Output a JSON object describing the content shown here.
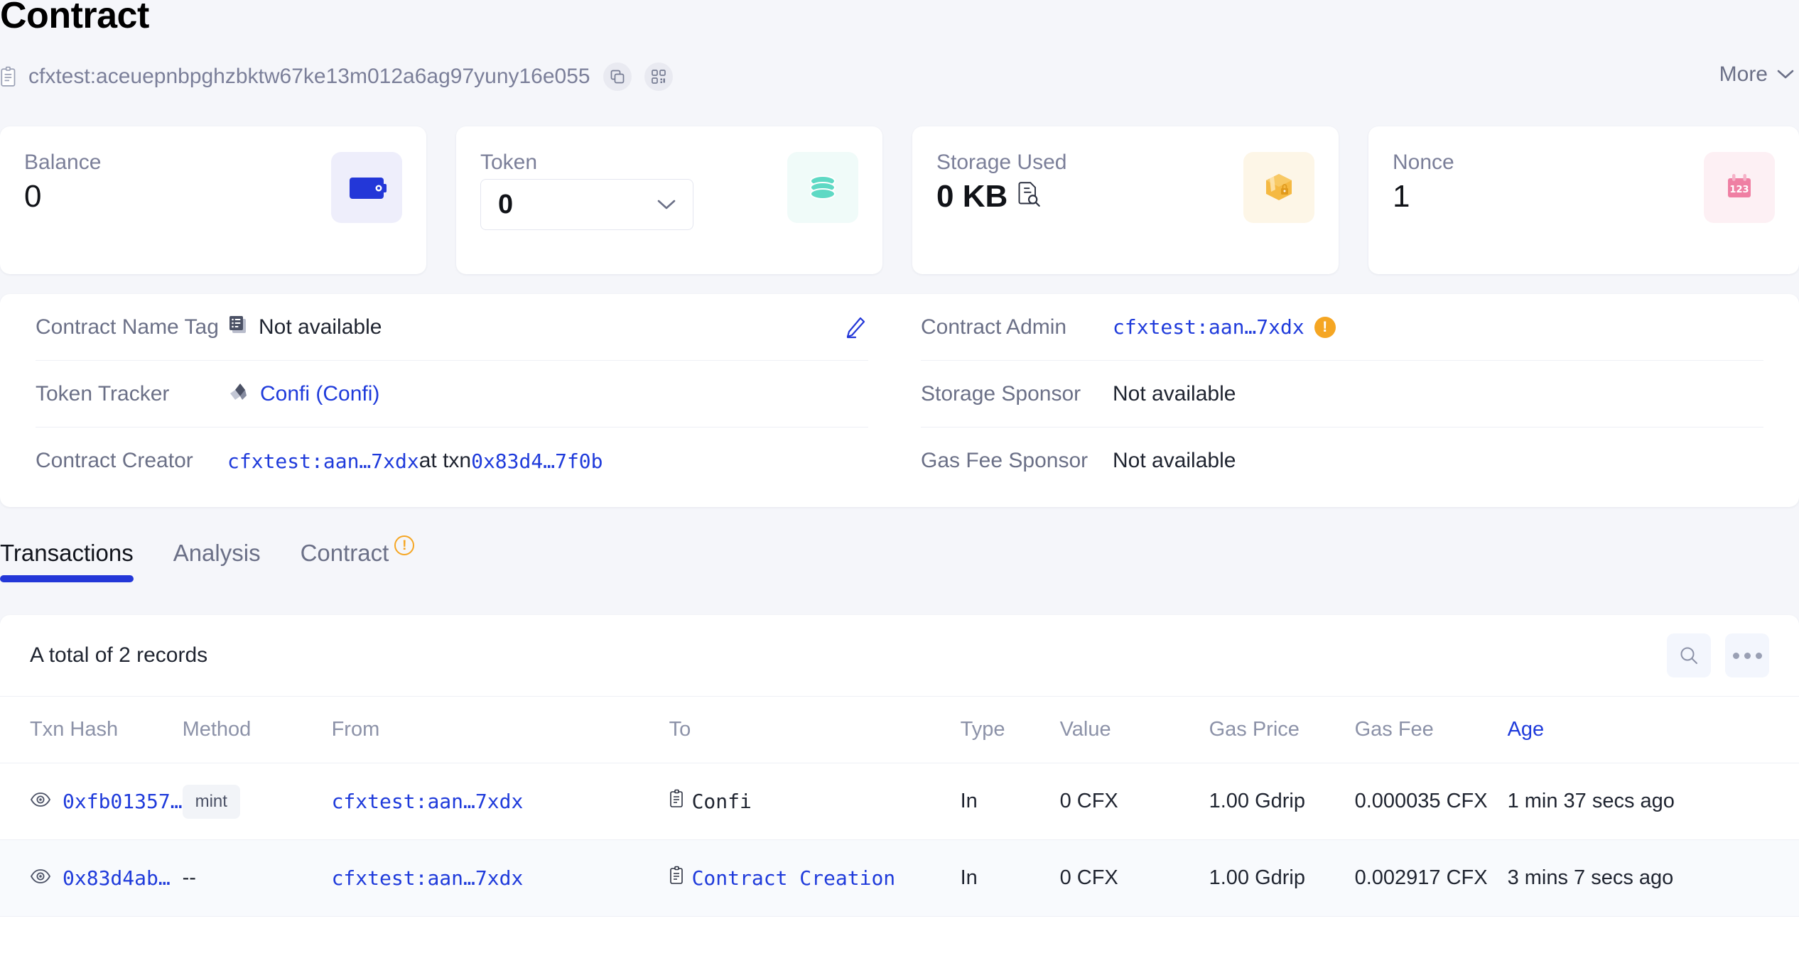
{
  "header": {
    "title": "Contract",
    "address": "cfxtest:aceuepnbpghzbktw67ke13m012a6ag97yuny16e055",
    "copy_icon": "copy-icon",
    "qr_icon": "qrcode-icon",
    "doc_icon": "contract-doc-icon",
    "more_label": "More",
    "more_icon": "chevron-down-icon"
  },
  "cards": [
    {
      "label": "Balance",
      "value": "0",
      "icon": "wallet-icon",
      "accent": "#2337d8",
      "bg": "#eeeefb"
    },
    {
      "label": "Token",
      "value": "0",
      "icon": "coins-icon",
      "accent": "#5fd9c4",
      "bg": "#f0fbf9",
      "is_select": true,
      "select_icon": "chevron-down-icon"
    },
    {
      "label": "Storage Used",
      "value": "0 KB",
      "icon": "package-lock-icon",
      "accent": "#f5b942",
      "bg": "#fdf6e7",
      "value_icon": "doc-search-icon"
    },
    {
      "label": "Nonce",
      "value": "1",
      "icon": "calendar-123-icon",
      "accent": "#ef7fa3",
      "bg": "#fdf0f4"
    }
  ],
  "info_left": [
    {
      "key": "Contract Name Tag",
      "value": "Not available",
      "icon": "server-stack-icon",
      "has_edit": true,
      "edit_icon": "pencil-icon"
    },
    {
      "key": "Token Tracker",
      "value": "Confi (Confi)",
      "icon": "token-tracker-icon",
      "is_link": true
    },
    {
      "key": "Contract Creator",
      "value_link1": "cfxtest:aan…7xdx",
      "value_mid": " at txn ",
      "value_link2": "0x83d4…7f0b"
    }
  ],
  "info_right": [
    {
      "key": "Contract Admin",
      "value": "cfxtest:aan…7xdx",
      "is_link": true,
      "badge": "!",
      "badge_icon": "warning-badge-icon"
    },
    {
      "key": "Storage Sponsor",
      "value": "Not available"
    },
    {
      "key": "Gas Fee Sponsor",
      "value": "Not available"
    }
  ],
  "tabs": [
    {
      "label": "Transactions",
      "active": true
    },
    {
      "label": "Analysis",
      "active": false
    },
    {
      "label": "Contract",
      "active": false,
      "warn": "!",
      "warn_icon": "warning-circle-icon"
    }
  ],
  "table": {
    "records_text": "A total of 2 records",
    "search_icon": "search-icon",
    "more_icon": "ellipsis-icon",
    "columns": [
      "Txn Hash",
      "Method",
      "From",
      "To",
      "Type",
      "Value",
      "Gas Price",
      "Gas Fee",
      "Age"
    ],
    "sorted_column": "Age",
    "rows": [
      {
        "eye_icon": "eye-icon",
        "hash": "0xfb01357…",
        "method": "mint",
        "from": "cfxtest:aan…7xdx",
        "to": "Confi",
        "to_icon": "contract-doc-icon",
        "to_is_link": false,
        "type": "In",
        "value": "0 CFX",
        "gas_price": "1.00 Gdrip",
        "gas_fee": "0.000035 CFX",
        "age": "1 min 37 secs ago"
      },
      {
        "eye_icon": "eye-icon",
        "hash": "0x83d4ab…",
        "method": "--",
        "from": "cfxtest:aan…7xdx",
        "to": "Contract Creation",
        "to_icon": "contract-doc-icon",
        "to_is_link": true,
        "type": "In",
        "value": "0 CFX",
        "gas_price": "1.00 Gdrip",
        "gas_fee": "0.002917 CFX",
        "age": "3 mins 7 secs ago"
      }
    ]
  }
}
